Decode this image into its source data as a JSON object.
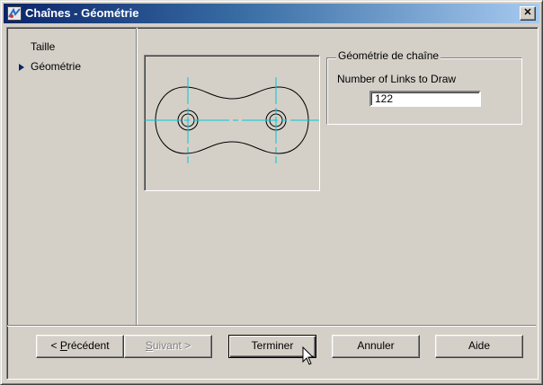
{
  "window": {
    "title": "Chaînes - Géométrie"
  },
  "nav": {
    "items": [
      {
        "label": "Taille"
      },
      {
        "label": "Géométrie",
        "selected": true
      }
    ]
  },
  "group": {
    "legend": "Géométrie de chaîne",
    "field_label": "Number of Links to Draw",
    "field_value": "122"
  },
  "buttons": {
    "back_prefix": "< ",
    "back_mnemonic": "P",
    "back_rest": "récédent",
    "next_mnemonic": "S",
    "next_rest": "uivant >",
    "finish": "Terminer",
    "cancel": "Annuler",
    "help": "Aide"
  },
  "colors": {
    "title_start": "#0a246a",
    "title_end": "#a6caf0",
    "face": "#d4d0c8",
    "centerline": "#00c8d8"
  },
  "icons": {
    "window": "app-icon",
    "close": "close-icon",
    "selected_item": "triangle-right-icon",
    "preview": "chain-link-drawing",
    "cursor": "mouse-pointer-icon"
  }
}
